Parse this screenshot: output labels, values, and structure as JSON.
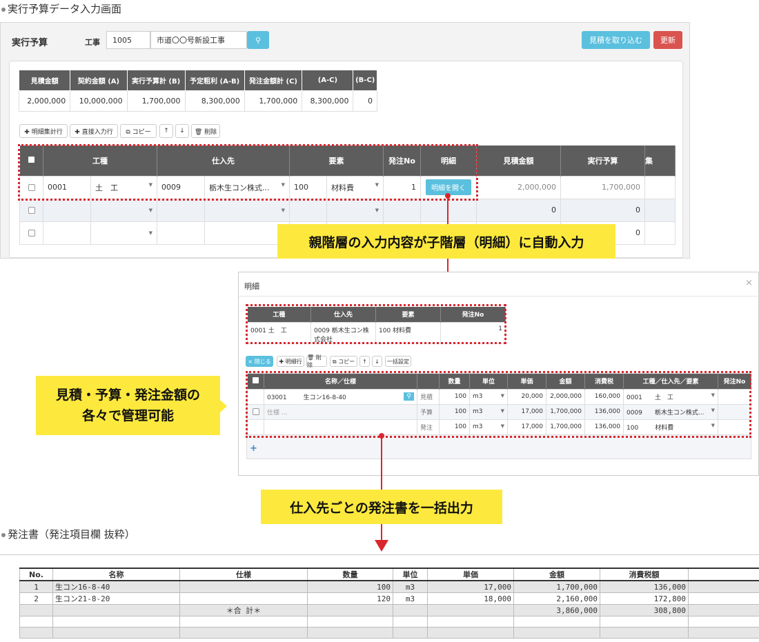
{
  "caption_top": "実行予算データ入力画面",
  "top": {
    "title": "実行予算",
    "koji_label": "工事",
    "koji_code": "1005",
    "koji_name": "市道〇〇号新設工事",
    "btn_import": "見積を取り込む",
    "btn_update": "更新",
    "summary_headers": [
      "見積金額",
      "契約金額 (A)",
      "実行予算計 (B)",
      "予定粗利 (A-B)",
      "発注金額計 (C)",
      "(A-C)",
      "(B-C)"
    ],
    "summary_values": [
      "2,000,000",
      "10,000,000",
      "1,700,000",
      "8,300,000",
      "1,700,000",
      "8,300,000",
      "0"
    ],
    "toolbar": [
      "✚ 明細集計行",
      "✚ 直接入力行",
      "⧉ コピー",
      "↑",
      "↓",
      "🗑 削除"
    ],
    "grid_headers": [
      "工種",
      "仕入先",
      "要素",
      "発注No",
      "明細",
      "見積金額",
      "実行予算",
      "集"
    ],
    "row1": {
      "kcode": "0001",
      "kname": "土　工",
      "scode": "0009",
      "sname": "栃木生コン株式...",
      "ycode": "100",
      "yname": "材料費",
      "no": "1",
      "btn": "明細を開く",
      "mitsu": "2,000,000",
      "jikko": "1,700,000"
    },
    "row2": {
      "mitsu": "0",
      "jikko": "0"
    },
    "row3": {
      "jikko": "0"
    }
  },
  "callout1": "親階層の入力内容が子階層（明細）に自動入力",
  "callout2_l1": "見積・予算・発注金額の",
  "callout2_l2": "各々で管理可能",
  "callout3": "仕入先ごとの発注書を一括出力",
  "modal": {
    "title": "明細",
    "close": "×",
    "parent_headers": [
      "工種",
      "仕入先",
      "要素",
      "発注No"
    ],
    "parent_row": [
      "0001 土　工",
      "0009 栃木生コン株式会社",
      "100 材料費",
      "1"
    ],
    "toolbar": [
      "× 閉じる",
      "✚ 明細行",
      "🗑 削除",
      "⧉ コピー",
      "↑",
      "↓",
      "一括設定"
    ],
    "headers": [
      "名称／仕様",
      "数量",
      "単位",
      "単価",
      "金額",
      "消費税",
      "工種／仕入先／要素",
      "発注No"
    ],
    "code": "03001",
    "name": "生コン16-8-40",
    "spec_ph": "仕様 ...",
    "rows": [
      {
        "kind": "見積",
        "qty": "100",
        "unit": "m3",
        "price": "20,000",
        "amount": "2,000,000",
        "tax": "160,000",
        "k1": "0001",
        "k2": "土　工"
      },
      {
        "kind": "予算",
        "qty": "100",
        "unit": "m3",
        "price": "17,000",
        "amount": "1,700,000",
        "tax": "136,000",
        "k1": "0009",
        "k2": "栃木生コン株式..."
      },
      {
        "kind": "発注",
        "qty": "100",
        "unit": "m3",
        "price": "17,000",
        "amount": "1,700,000",
        "tax": "136,000",
        "k1": "100",
        "k2": "材料費"
      }
    ],
    "add": "+"
  },
  "caption_po": "発注書（発注項目欄 抜粋）",
  "po": {
    "headers": [
      "No.",
      "名称",
      "仕様",
      "数量",
      "単位",
      "単価",
      "金額",
      "消費税額"
    ],
    "rows": [
      [
        "1",
        "生コン16-8-40",
        "",
        "100",
        "m3",
        "17,000",
        "1,700,000",
        "136,000"
      ],
      [
        "2",
        "生コン21-8-20",
        "",
        "120",
        "m3",
        "18,000",
        "2,160,000",
        "172,800"
      ],
      [
        "",
        "",
        "＊合 計＊",
        "",
        "",
        "",
        "3,860,000",
        "308,800"
      ],
      [
        "",
        "",
        "",
        "",
        "",
        "",
        "",
        ""
      ],
      [
        "",
        "",
        "",
        "",
        "",
        "",
        "",
        ""
      ]
    ]
  }
}
